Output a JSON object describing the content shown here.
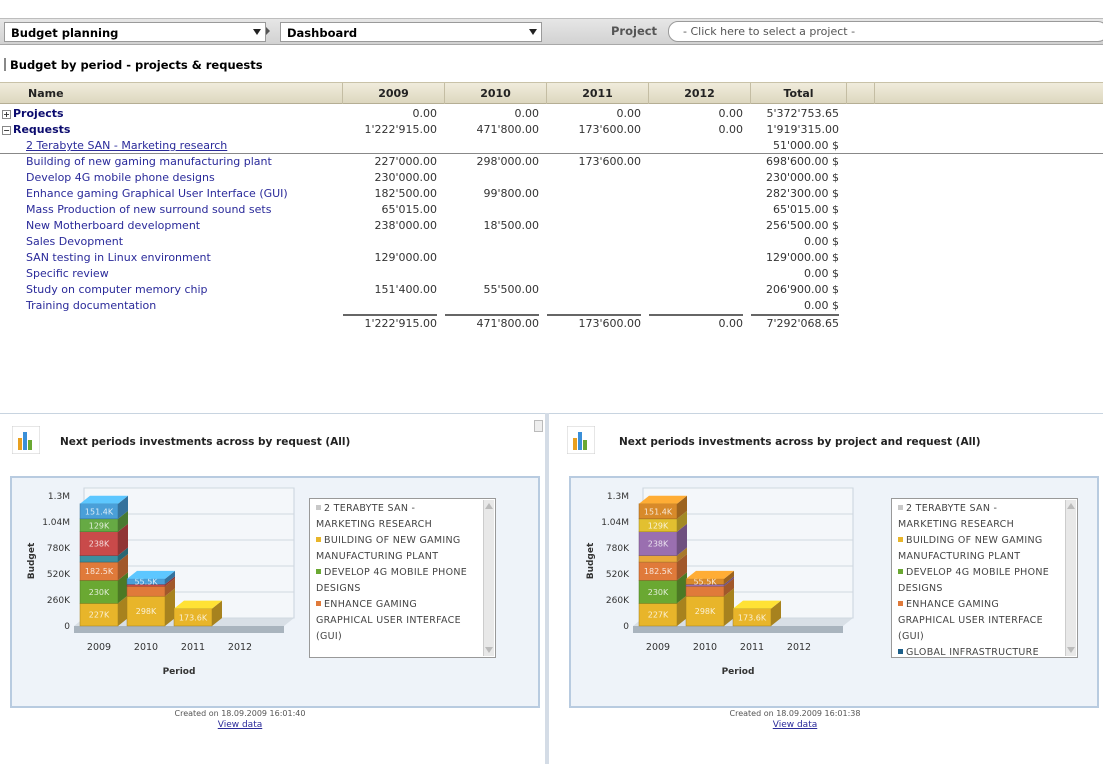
{
  "toolbar": {
    "module": "Budget planning",
    "view": "Dashboard",
    "project_label": "Project",
    "project_placeholder": "- Click here to select a project -"
  },
  "section_title": "Budget by period - projects & requests",
  "table": {
    "headers": [
      "Name",
      "2009",
      "2010",
      "2011",
      "2012",
      "Total"
    ],
    "groups": [
      {
        "toggle": "+",
        "name": "Projects",
        "values": [
          "0.00",
          "0.00",
          "0.00",
          "0.00",
          "5'372'753.65"
        ]
      },
      {
        "toggle": "−",
        "name": "Requests",
        "values": [
          "1'222'915.00",
          "471'800.00",
          "173'600.00",
          "0.00",
          "1'919'315.00"
        ]
      }
    ],
    "requests": [
      {
        "name": "2 Terabyte SAN - Marketing research",
        "values": [
          "",
          "",
          "",
          "",
          "51'000.00 $"
        ]
      },
      {
        "name": "Building of new gaming manufacturing plant",
        "values": [
          "227'000.00",
          "298'000.00",
          "173'600.00",
          "",
          "698'600.00 $"
        ]
      },
      {
        "name": "Develop 4G mobile phone designs",
        "values": [
          "230'000.00",
          "",
          "",
          "",
          "230'000.00 $"
        ]
      },
      {
        "name": "Enhance gaming Graphical User Interface (GUI)",
        "values": [
          "182'500.00",
          "99'800.00",
          "",
          "",
          "282'300.00 $"
        ]
      },
      {
        "name": "Mass Production of new surround sound sets",
        "values": [
          "65'015.00",
          "",
          "",
          "",
          "65'015.00 $"
        ]
      },
      {
        "name": "New Motherboard development",
        "values": [
          "238'000.00",
          "18'500.00",
          "",
          "",
          "256'500.00 $"
        ]
      },
      {
        "name": "Sales Devopment",
        "values": [
          "",
          "",
          "",
          "",
          "0.00 $"
        ]
      },
      {
        "name": "SAN testing in Linux environment",
        "values": [
          "129'000.00",
          "",
          "",
          "",
          "129'000.00 $"
        ]
      },
      {
        "name": "Specific review",
        "values": [
          "",
          "",
          "",
          "",
          "0.00 $"
        ]
      },
      {
        "name": "Study on computer memory chip",
        "values": [
          "151'400.00",
          "55'500.00",
          "",
          "",
          "206'900.00 $"
        ]
      },
      {
        "name": "Training documentation",
        "values": [
          "",
          "",
          "",
          "",
          "0.00 $"
        ]
      }
    ],
    "totals": [
      "1'222'915.00",
      "471'800.00",
      "173'600.00",
      "0.00",
      "7'292'068.65"
    ]
  },
  "panels": [
    {
      "title": "Next periods investments across by request (All)",
      "legend": [
        {
          "text": "2 TERABYTE SAN - MARKETING RESEARCH",
          "color": "#c8c8c8"
        },
        {
          "text": "BUILDING OF NEW GAMING MANUFACTURING PLANT",
          "color": "#e8b52a"
        },
        {
          "text": "DEVELOP 4G MOBILE PHONE DESIGNS",
          "color": "#6aa832"
        },
        {
          "text": "ENHANCE GAMING GRAPHICAL USER INTERFACE (GUI)",
          "color": "#e07a3a"
        }
      ],
      "caption": "Created on 18.09.2009 16:01:40",
      "link": "View data"
    },
    {
      "title": "Next periods investments across by project and request (All)",
      "legend": [
        {
          "text": "2 TERABYTE SAN - MARKETING RESEARCH",
          "color": "#c8c8c8"
        },
        {
          "text": "BUILDING OF NEW GAMING MANUFACTURING PLANT",
          "color": "#e8b52a"
        },
        {
          "text": "DEVELOP 4G MOBILE PHONE DESIGNS",
          "color": "#6aa832"
        },
        {
          "text": "ENHANCE GAMING GRAPHICAL USER INTERFACE (GUI)",
          "color": "#e07a3a"
        },
        {
          "text": "GLOBAL INFRASTRUCTURE",
          "color": "#1c5f8a"
        }
      ],
      "caption": "Created on 18.09.2009 16:01:38",
      "link": "View data"
    }
  ],
  "chart_data": [
    {
      "type": "bar",
      "stacked": true,
      "3d": true,
      "xlabel": "Period",
      "ylabel": "Budget",
      "categories": [
        "2009",
        "2010",
        "2011",
        "2012"
      ],
      "yticks": [
        "0",
        "260K",
        "520K",
        "780K",
        "1.04M",
        "1.3M"
      ],
      "ylim": [
        0,
        1300000
      ],
      "series": [
        {
          "name": "BUILDING OF NEW GAMING MANUFACTURING PLANT",
          "color": "#e8b52a",
          "values": [
            227000,
            298000,
            173600,
            0
          ],
          "labels": [
            "227K",
            "298K",
            "173.6K",
            ""
          ]
        },
        {
          "name": "DEVELOP 4G MOBILE PHONE DESIGNS",
          "color": "#6aa832",
          "values": [
            230000,
            0,
            0,
            0
          ],
          "labels": [
            "230K",
            "",
            "",
            ""
          ]
        },
        {
          "name": "ENHANCE GAMING GRAPHICAL USER INTERFACE (GUI)",
          "color": "#e07a3a",
          "values": [
            182500,
            99800,
            0,
            0
          ],
          "labels": [
            "182.5K",
            "",
            "",
            ""
          ]
        },
        {
          "name": "",
          "color": "#3b8fa0",
          "values": [
            65015,
            0,
            0,
            0
          ],
          "labels": [
            "",
            "",
            "",
            ""
          ]
        },
        {
          "name": "",
          "color": "#c94a4a",
          "values": [
            238000,
            18500,
            0,
            0
          ],
          "labels": [
            "238K",
            "",
            "",
            ""
          ]
        },
        {
          "name": "",
          "color": "#66aa44",
          "values": [
            129000,
            0,
            0,
            0
          ],
          "labels": [
            "129K",
            "",
            "",
            ""
          ]
        },
        {
          "name": "",
          "color": "#4a9fd8",
          "values": [
            151400,
            55500,
            0,
            0
          ],
          "labels": [
            "151.4K",
            "55.5K",
            "",
            ""
          ]
        }
      ]
    },
    {
      "type": "bar",
      "stacked": true,
      "3d": true,
      "xlabel": "Period",
      "ylabel": "Budget",
      "categories": [
        "2009",
        "2010",
        "2011",
        "2012"
      ],
      "yticks": [
        "0",
        "260K",
        "520K",
        "780K",
        "1.04M",
        "1.3M"
      ],
      "ylim": [
        0,
        1300000
      ],
      "series": [
        {
          "name": "BUILDING OF NEW GAMING MANUFACTURING PLANT",
          "color": "#e8b52a",
          "values": [
            227000,
            298000,
            173600,
            0
          ],
          "labels": [
            "227K",
            "298K",
            "173.6K",
            ""
          ]
        },
        {
          "name": "DEVELOP 4G MOBILE PHONE DESIGNS",
          "color": "#6aa832",
          "values": [
            230000,
            0,
            0,
            0
          ],
          "labels": [
            "230K",
            "",
            "",
            ""
          ]
        },
        {
          "name": "ENHANCE GAMING GRAPHICAL USER INTERFACE (GUI)",
          "color": "#e07a3a",
          "values": [
            182500,
            99800,
            0,
            0
          ],
          "labels": [
            "182.5K",
            "",
            "",
            ""
          ]
        },
        {
          "name": "",
          "color": "#e8a83a",
          "values": [
            65015,
            0,
            0,
            0
          ],
          "labels": [
            "",
            "",
            "",
            ""
          ]
        },
        {
          "name": "",
          "color": "#9a6fb0",
          "values": [
            238000,
            18500,
            0,
            0
          ],
          "labels": [
            "238K",
            "",
            "",
            ""
          ]
        },
        {
          "name": "",
          "color": "#e2c030",
          "values": [
            129000,
            0,
            0,
            0
          ],
          "labels": [
            "129K",
            "",
            "",
            ""
          ]
        },
        {
          "name": "",
          "color": "#d88a2a",
          "values": [
            151400,
            55500,
            0,
            0
          ],
          "labels": [
            "151.4K",
            "55.5K",
            "",
            ""
          ]
        }
      ]
    }
  ]
}
